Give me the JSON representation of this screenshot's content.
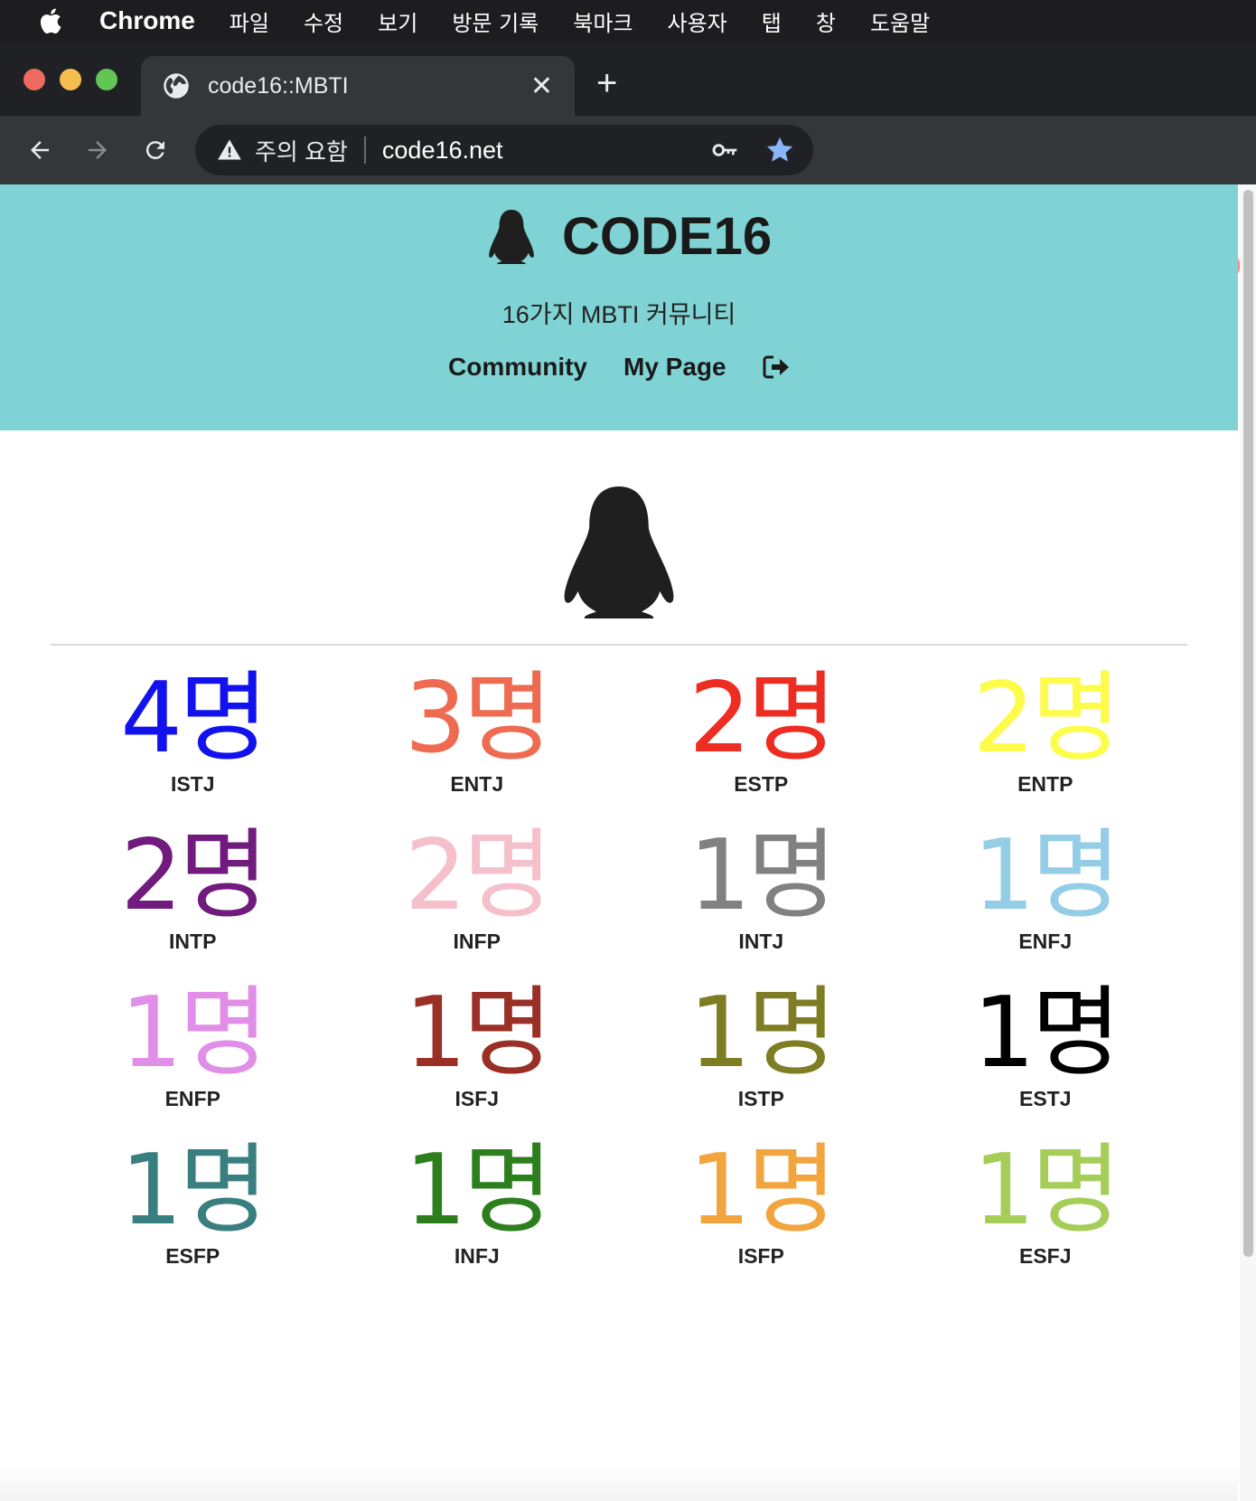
{
  "menubar": {
    "app_name": "Chrome",
    "items": [
      "파일",
      "수정",
      "보기",
      "방문 기록",
      "북마크",
      "사용자",
      "탭",
      "창",
      "도움말"
    ]
  },
  "browser": {
    "tab_title": "code16::MBTI",
    "tab_close": "✕",
    "new_tab": "+",
    "security_label": "주의 요함",
    "url": "code16.net"
  },
  "site": {
    "brand": "CODE16",
    "tagline": "16가지 MBTI 커뮤니티",
    "nav": [
      "Community",
      "My Page"
    ]
  },
  "stats": [
    {
      "count": "4명",
      "type": "ISTJ",
      "color": "#1212ee"
    },
    {
      "count": "3명",
      "type": "ENTJ",
      "color": "#ee6b51"
    },
    {
      "count": "2명",
      "type": "ESTP",
      "color": "#ee2d22"
    },
    {
      "count": "2명",
      "type": "ENTP",
      "color": "#fdfc4a"
    },
    {
      "count": "2명",
      "type": "INTP",
      "color": "#701b7d"
    },
    {
      "count": "2명",
      "type": "INFP",
      "color": "#f5c0cb"
    },
    {
      "count": "1명",
      "type": "INTJ",
      "color": "#818181"
    },
    {
      "count": "1명",
      "type": "ENFJ",
      "color": "#94cde6"
    },
    {
      "count": "1명",
      "type": "ENFP",
      "color": "#e18ee8"
    },
    {
      "count": "1명",
      "type": "ISFJ",
      "color": "#9a2f26"
    },
    {
      "count": "1명",
      "type": "ISTP",
      "color": "#7f7d24"
    },
    {
      "count": "1명",
      "type": "ESTJ",
      "color": "#000000"
    },
    {
      "count": "1명",
      "type": "ESFP",
      "color": "#3a7f7f"
    },
    {
      "count": "1명",
      "type": "INFJ",
      "color": "#2d7f1e"
    },
    {
      "count": "1명",
      "type": "ISFP",
      "color": "#f2a43e"
    },
    {
      "count": "1명",
      "type": "ESFJ",
      "color": "#a6cd58"
    }
  ],
  "colors": {
    "header_bg": "#80d3d4",
    "tab_bg": "#35363a",
    "titlebar_bg": "#202124"
  }
}
